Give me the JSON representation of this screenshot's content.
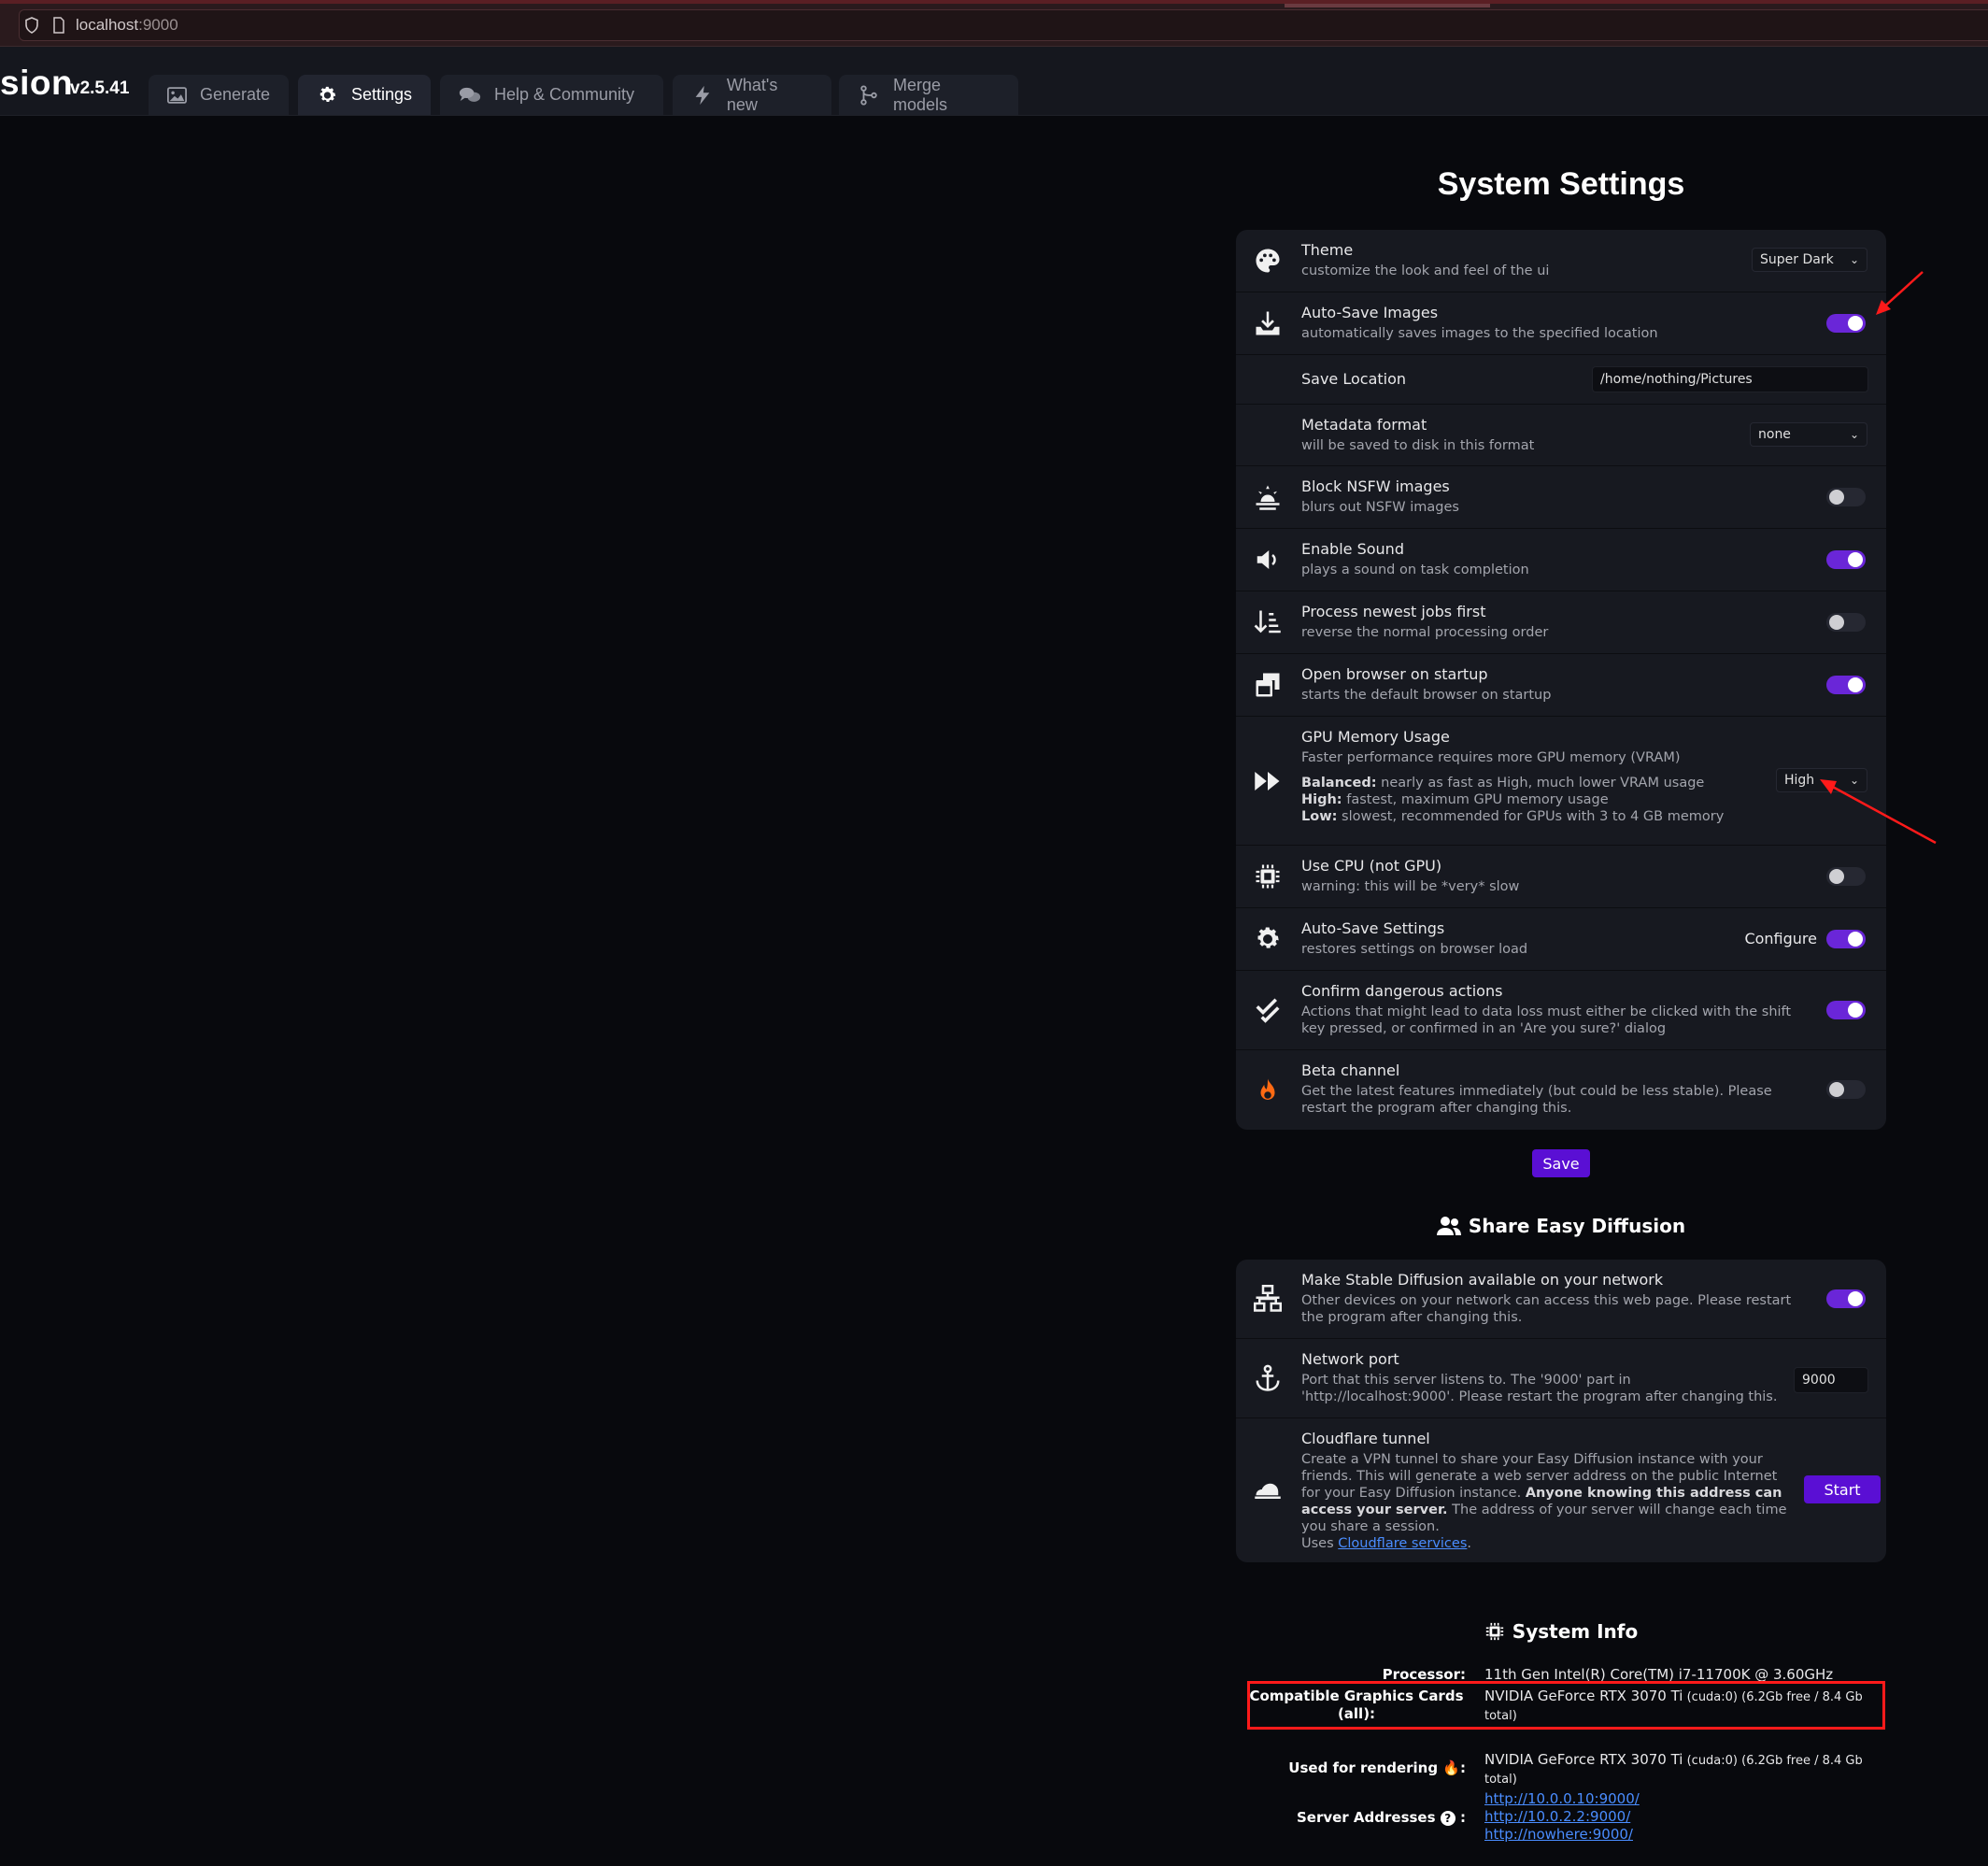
{
  "browser": {
    "url_host": "localhost",
    "url_port": ":9000"
  },
  "app": {
    "logo": "sion",
    "version": "v2.5.41"
  },
  "tabs": [
    {
      "label": "Generate",
      "icon": "image-icon"
    },
    {
      "label": "Settings",
      "icon": "gear-icon",
      "active": true
    },
    {
      "label": "Help & Community",
      "icon": "comments-icon"
    },
    {
      "label": "What's new",
      "icon": "bolt-icon"
    },
    {
      "label": "Merge models",
      "icon": "code-merge-icon"
    }
  ],
  "settings": {
    "title": "System Settings",
    "rows": [
      {
        "label": "Theme",
        "desc": "customize the look and feel of the ui",
        "select": "Super Dark"
      },
      {
        "label": "Auto-Save Images",
        "desc": "automatically saves images to the specified location",
        "toggle": true
      },
      {
        "label": "Save Location",
        "value": "/home/nothing/Pictures"
      },
      {
        "label": "Metadata format",
        "desc": "will be saved to disk in this format",
        "select": "none"
      },
      {
        "label": "Block NSFW images",
        "desc": "blurs out NSFW images",
        "toggle": false
      },
      {
        "label": "Enable Sound",
        "desc": "plays a sound on task completion",
        "toggle": true
      },
      {
        "label": "Process newest jobs first",
        "desc": "reverse the normal processing order",
        "toggle": false
      },
      {
        "label": "Open browser on startup",
        "desc": "starts the default browser on startup",
        "toggle": true
      },
      {
        "label": "GPU Memory Usage",
        "desc": "Faster performance requires more GPU memory (VRAM)",
        "options_help": [
          {
            "name": "Balanced:",
            "text": " nearly as fast as High, much lower VRAM usage"
          },
          {
            "name": "High:",
            "text": " fastest, maximum GPU memory usage"
          },
          {
            "name": "Low:",
            "text": " slowest, recommended for GPUs with 3 to 4 GB memory"
          }
        ],
        "select": "High"
      },
      {
        "label": "Use CPU (not GPU)",
        "desc": "warning: this will be *very* slow",
        "toggle": false
      },
      {
        "label": "Auto-Save Settings",
        "desc": "restores settings on browser load",
        "toggle": true,
        "button": "Configure"
      },
      {
        "label": "Confirm dangerous actions",
        "desc": "Actions that might lead to data loss must either be clicked with the shift key pressed, or confirmed in an 'Are you sure?' dialog",
        "toggle": true
      },
      {
        "label": "Beta channel",
        "desc": "Get the latest features immediately (but could be less stable). Please restart the program after changing this.",
        "toggle": false
      }
    ],
    "save_label": "Save"
  },
  "share": {
    "title": "Share Easy Diffusion",
    "rows": [
      {
        "label": "Make Stable Diffusion available on your network",
        "desc": "Other devices on your network can access this web page. Please restart the program after changing this.",
        "toggle": true
      },
      {
        "label": "Network port",
        "desc": "Port that this server listens to. The '9000' part in 'http://localhost:9000'. Please restart the program after changing this.",
        "value": "9000"
      },
      {
        "label": "Cloudflare tunnel",
        "desc_1": "Create a VPN tunnel to share your Easy Diffusion instance with your friends. This will generate a web server address on the public Internet for your Easy Diffusion instance. ",
        "desc_bold": "Anyone knowing this address can access your server.",
        "desc_2": " The address of your server will change each time you share a session.",
        "uses": "Uses ",
        "link": "Cloudflare services",
        "after_link": ".",
        "button": "Start"
      }
    ]
  },
  "system_info": {
    "title": "System Info",
    "processor_key": "Processor:",
    "processor_val": "11th Gen Intel(R) Core(TM) i7-11700K @ 3.60GHz",
    "gpus_key": "Compatible Graphics Cards (all):",
    "gpus_name": "NVIDIA GeForce RTX 3070 Ti",
    "gpus_detail": " (cuda:0) (6.2Gb free / 8.4 Gb total)",
    "render_key": "Used for rendering 🔥:",
    "render_name": "NVIDIA GeForce RTX 3070 Ti",
    "render_detail": " (cuda:0) (6.2Gb free / 8.4 Gb total)",
    "addresses_key": "Server Addresses",
    "addresses_suffix": ":",
    "addresses": [
      "http://10.0.0.10:9000/",
      "http://10.0.2.2:9000/",
      "http://nowhere:9000/"
    ]
  },
  "colors": {
    "accent": "#5a0fd4",
    "toggle_on": "#6a26d8",
    "annotation": "#ff1a1a"
  }
}
